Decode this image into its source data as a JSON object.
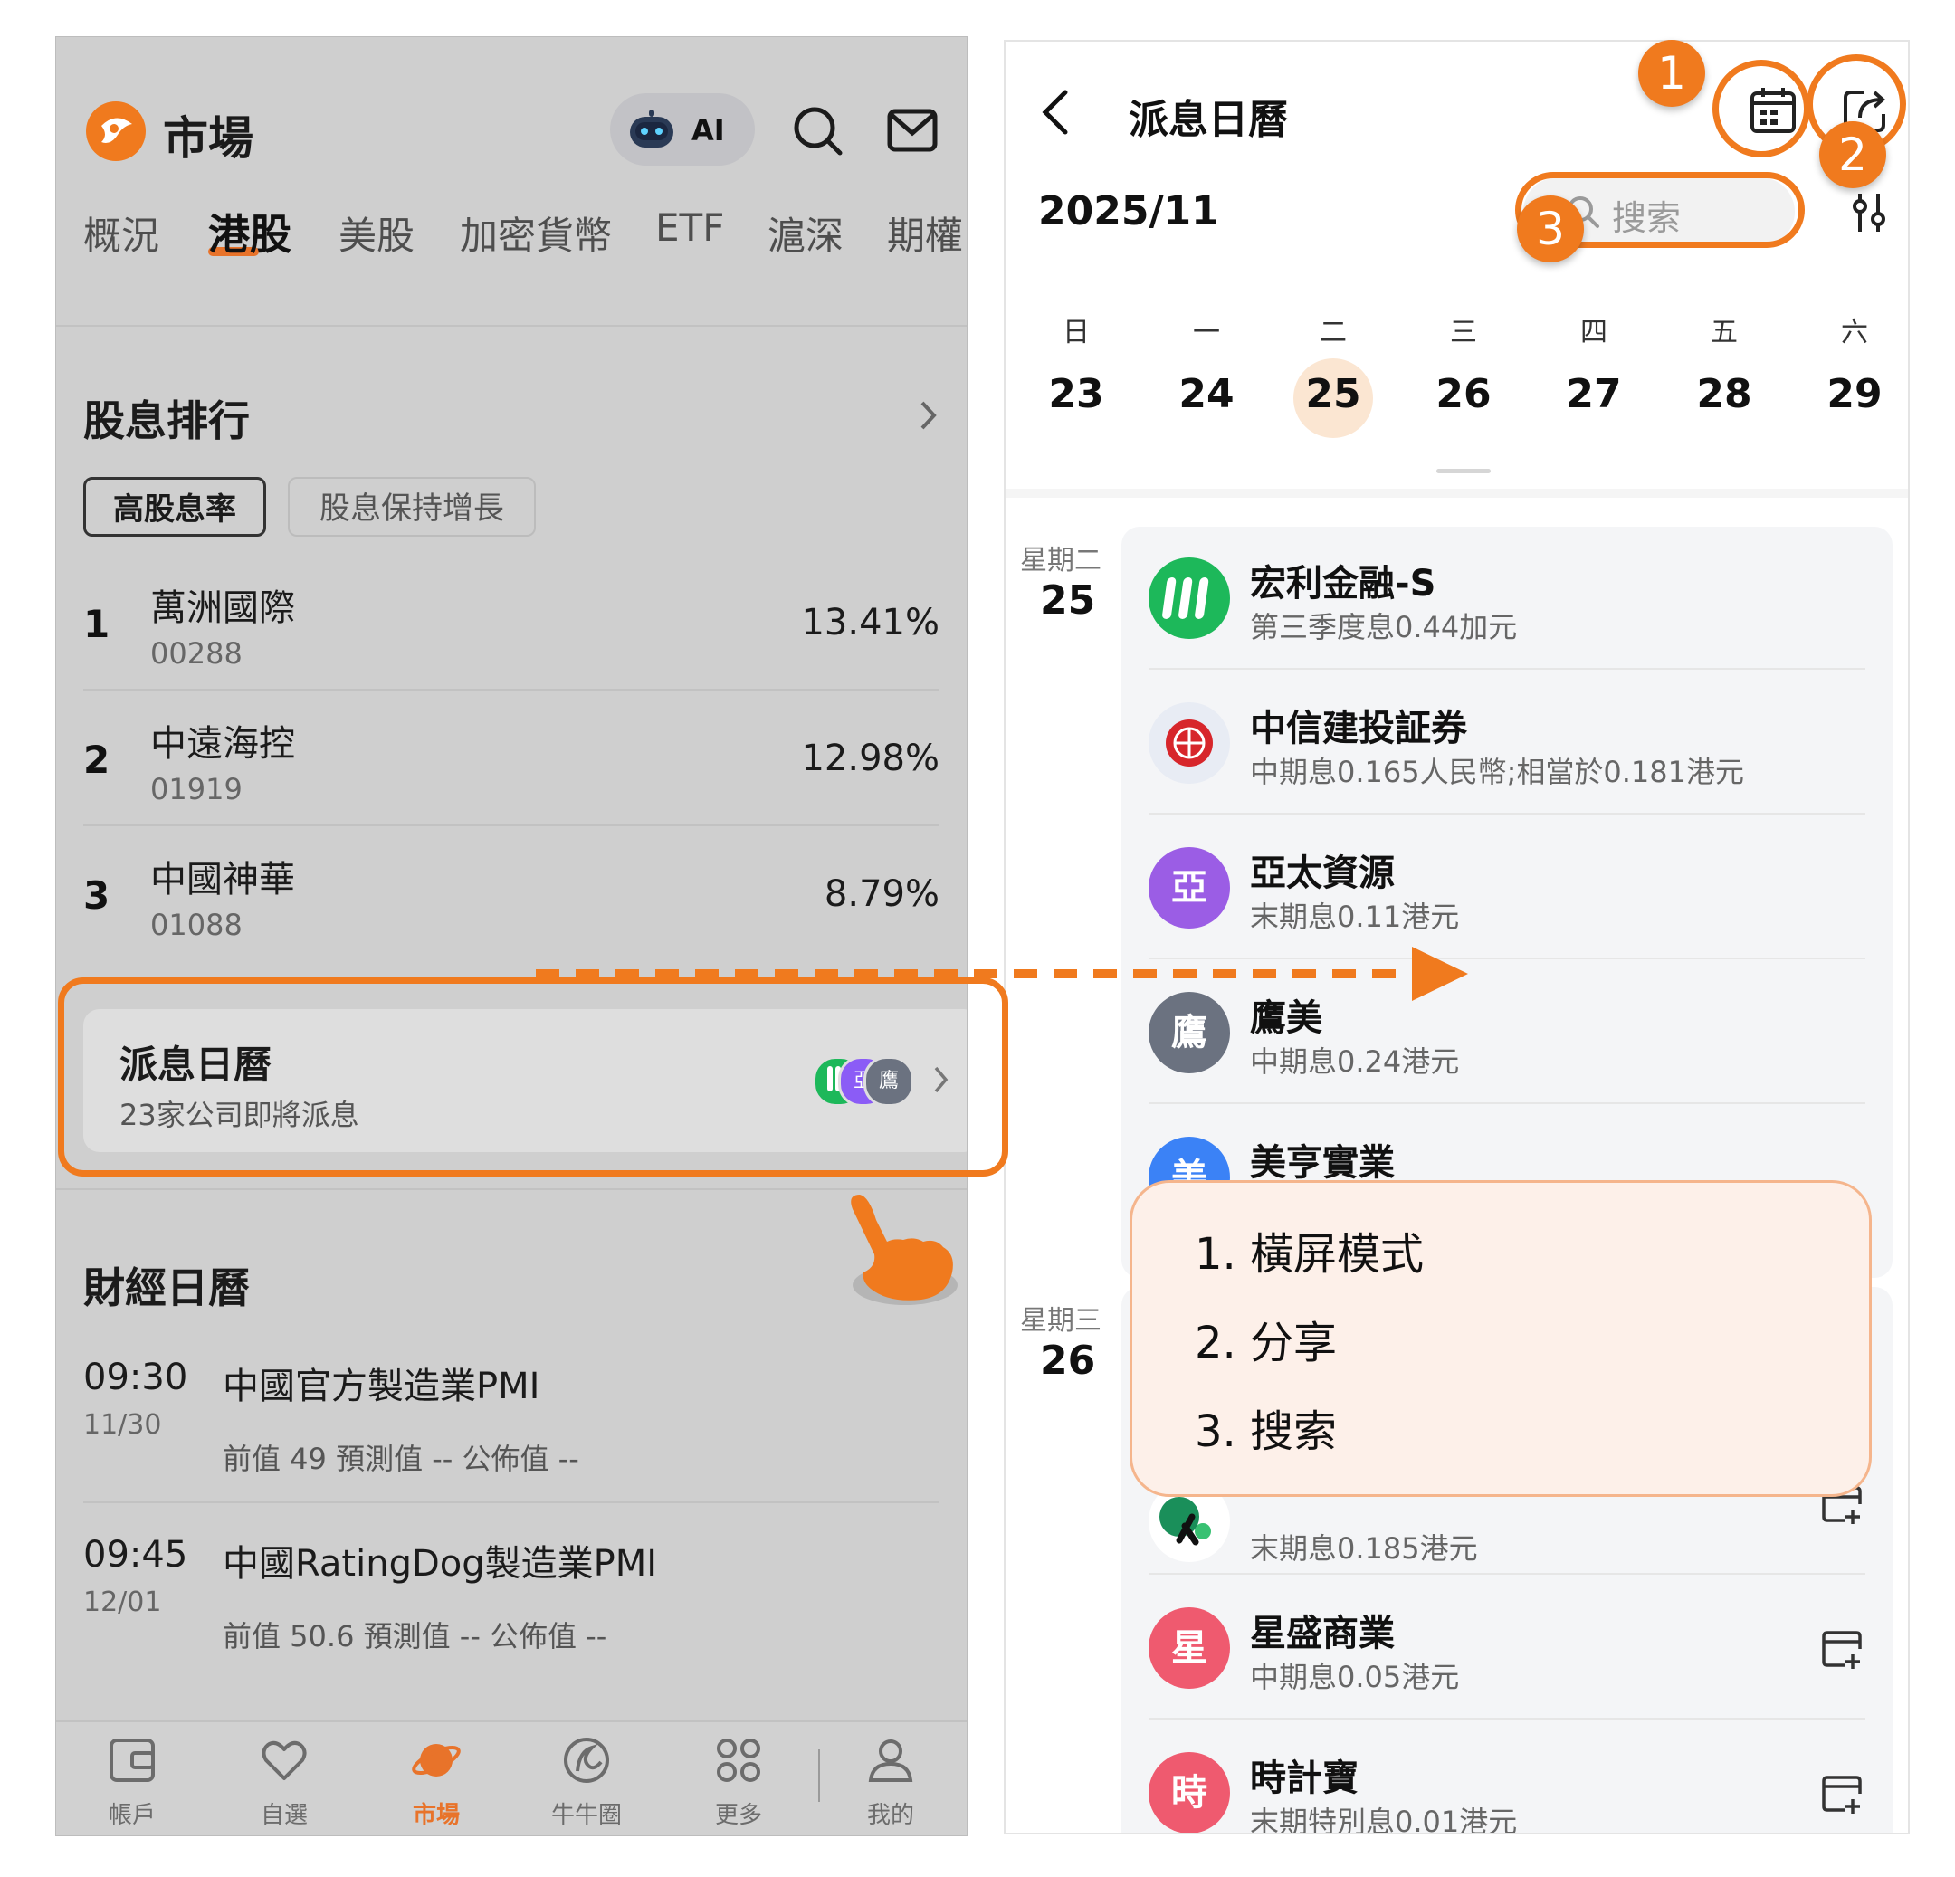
{
  "left": {
    "header": {
      "title": "市場",
      "ai_label": "AI"
    },
    "tabs": [
      "概況",
      "港股",
      "美股",
      "加密貨幣",
      "ETF",
      "滬深",
      "期權"
    ],
    "active_tab": "港股",
    "dividend_rank": {
      "title": "股息排行",
      "chips": [
        "高股息率",
        "股息保持增長"
      ],
      "items": [
        {
          "rank": "1",
          "name": "萬洲國際",
          "code": "00288",
          "yield": "13.41%"
        },
        {
          "rank": "2",
          "name": "中遠海控",
          "code": "01919",
          "yield": "12.98%"
        },
        {
          "rank": "3",
          "name": "中國神華",
          "code": "01088",
          "yield": "8.79%"
        }
      ]
    },
    "dividend_card": {
      "title": "派息日曆",
      "subtitle": "23家公司即將派息",
      "avatars": [
        {
          "text": "",
          "color": "#1db85a"
        },
        {
          "text": "亞",
          "color": "#8b5cf6"
        },
        {
          "text": "鷹",
          "color": "#6b7280"
        }
      ]
    },
    "econ_calendar": {
      "title": "財經日曆",
      "items": [
        {
          "time": "09:30",
          "date": "11/30",
          "name": "中國官方製造業PMI",
          "values": "前值 49  預測值 --  公佈值 --"
        },
        {
          "time": "09:45",
          "date": "12/01",
          "name": "中國RatingDog製造業PMI",
          "values": "前值 50.6  預測值 --  公佈值 --"
        }
      ]
    },
    "tabbar": [
      {
        "label": "帳戶",
        "icon": "wallet-icon"
      },
      {
        "label": "自選",
        "icon": "heart-icon"
      },
      {
        "label": "市場",
        "icon": "planet-icon",
        "active": true
      },
      {
        "label": "牛牛圈",
        "icon": "circle-swirl-icon"
      },
      {
        "label": "更多",
        "icon": "grid-icon"
      },
      {
        "label": "我的",
        "icon": "person-icon"
      }
    ]
  },
  "right": {
    "header": {
      "title": "派息日曆"
    },
    "month": "2025/11",
    "search_placeholder": "搜索",
    "weekdays": [
      "日",
      "一",
      "二",
      "三",
      "四",
      "五",
      "六"
    ],
    "dates": [
      "23",
      "24",
      "25",
      "26",
      "27",
      "28",
      "29"
    ],
    "selected_date": "25",
    "groups": [
      {
        "weekday": "星期二",
        "day": "25",
        "events": [
          {
            "avatar": "",
            "color": "#1db85a",
            "name": "宏利金融-S",
            "desc": "第三季度息0.44加元"
          },
          {
            "avatar": "",
            "color": "#e8ecf4",
            "name": "中信建投証券",
            "desc": "中期息0.165人民幣;相當於0.181港元"
          },
          {
            "avatar": "亞",
            "color": "#9b5de5",
            "name": "亞太資源",
            "desc": "末期息0.11港元"
          },
          {
            "avatar": "鷹",
            "color": "#6b7280",
            "name": "鷹美",
            "desc": "中期息0.24港元"
          },
          {
            "avatar": "美",
            "color": "#3b82f6",
            "name": "美亨實業",
            "desc": ""
          }
        ]
      },
      {
        "weekday": "星期三",
        "day": "26",
        "events": [
          {
            "avatar": "",
            "color": "#1a8f5a",
            "name": "",
            "desc": "末期息0.185港元"
          },
          {
            "avatar": "星",
            "color": "#ef5a6f",
            "name": "星盛商業",
            "desc": "中期息0.05港元"
          },
          {
            "avatar": "時",
            "color": "#ef5a6f",
            "name": "時計寶",
            "desc": "末期特別息0.01港元"
          }
        ]
      }
    ]
  },
  "annotations": {
    "badges": [
      "1",
      "2",
      "3"
    ],
    "popup_items": [
      "1. 橫屏模式",
      "2. 分享",
      "3. 搜索"
    ],
    "accent_color": "#f07a1e"
  }
}
